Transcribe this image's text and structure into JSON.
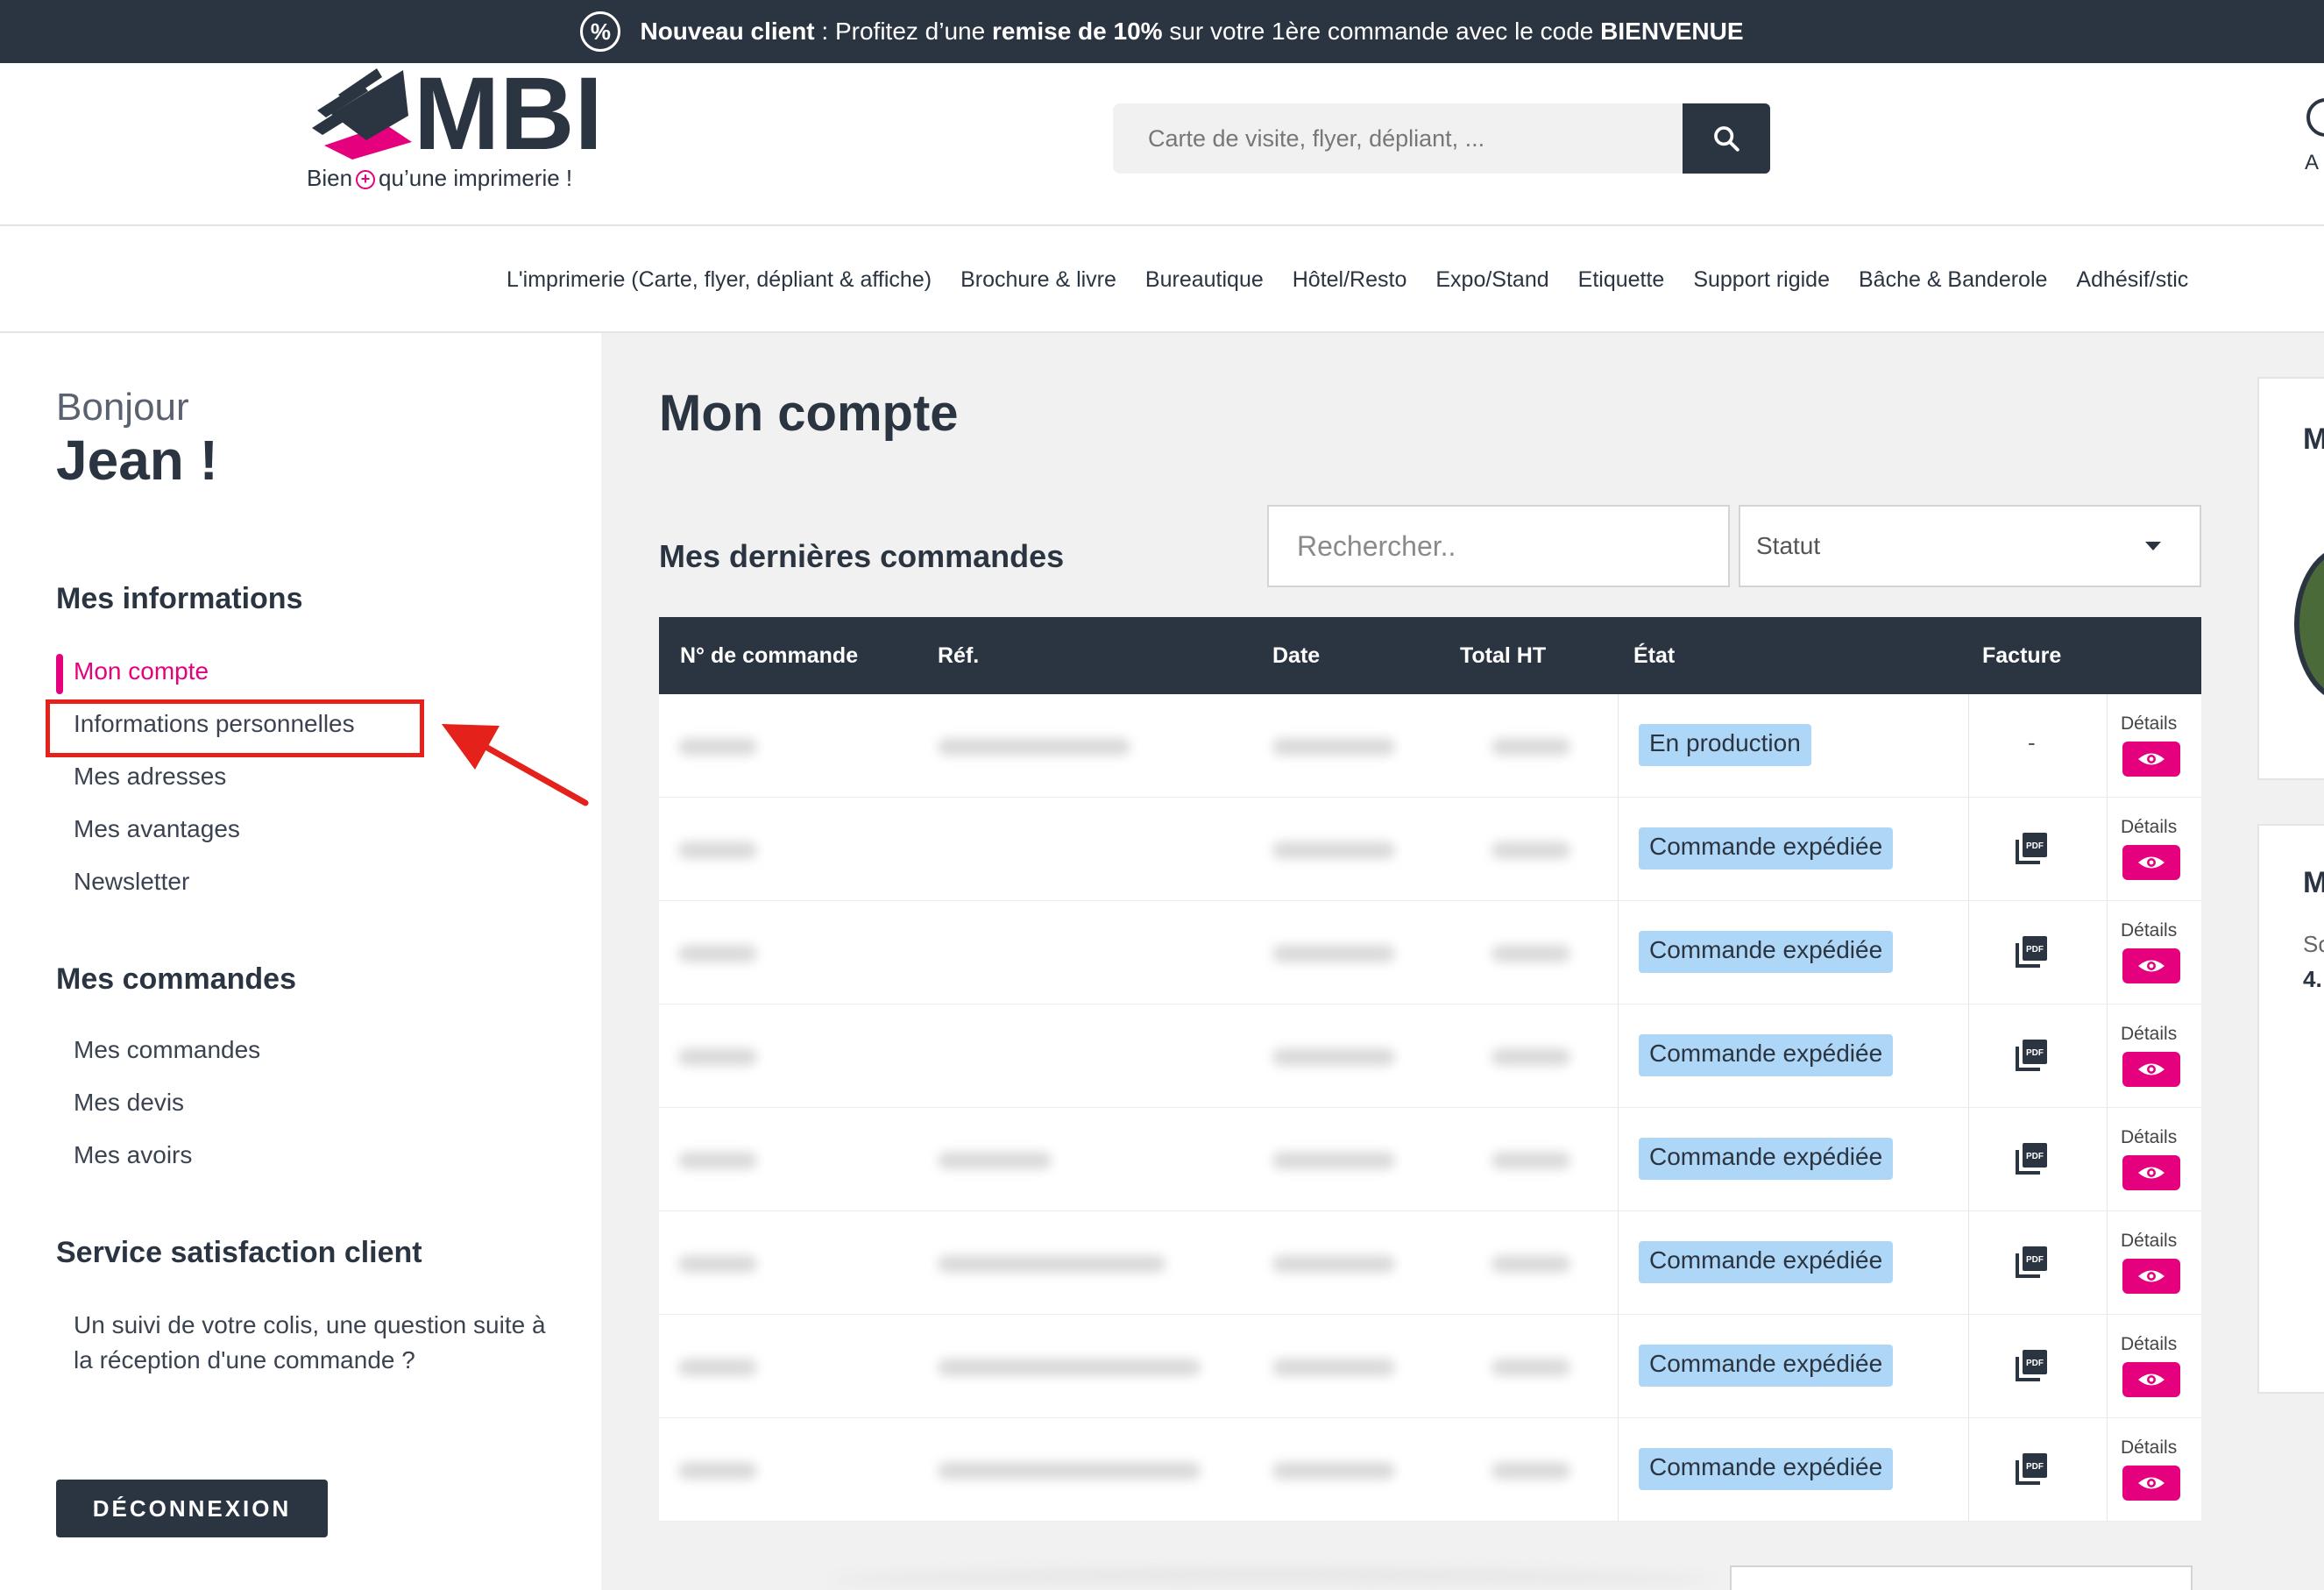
{
  "promo": {
    "lead": "Nouveau client",
    "sep": " : Profitez d’une ",
    "discount": "remise de 10%",
    "middle": " sur votre 1ère commande avec le code ",
    "code": "BIENVENUE",
    "icon": "percent-icon"
  },
  "header": {
    "logo_text": "MBI",
    "tagline_before": "Bien",
    "tagline_plus": "+",
    "tagline_after": "qu’une imprimerie !",
    "search_placeholder": "Carte de visite, flyer, dépliant, ...",
    "account_label": "A"
  },
  "nav": {
    "items": [
      "L'imprimerie (Carte, flyer, dépliant & affiche)",
      "Brochure & livre",
      "Bureautique",
      "Hôtel/Resto",
      "Expo/Stand",
      "Etiquette",
      "Support rigide",
      "Bâche & Banderole",
      "Adhésif/stic"
    ]
  },
  "sidebar": {
    "greeting": "Bonjour",
    "name": "Jean !",
    "info_title": "Mes informations",
    "info_links": [
      "Mon compte",
      "Informations personnelles",
      "Mes adresses",
      "Mes avantages",
      "Newsletter"
    ],
    "orders_title": "Mes commandes",
    "orders_links": [
      "Mes commandes",
      "Mes devis",
      "Mes avoirs"
    ],
    "service_title": "Service satisfaction client",
    "service_text": "Un suivi de votre colis, une question suite à la réception d'une commande ?",
    "logout": "DÉCONNEXION"
  },
  "main": {
    "title": "Mon compte",
    "orders_title": "Mes dernières commandes",
    "search_placeholder": "Rechercher..",
    "status_select": "Statut",
    "columns": {
      "number": "N° de commande",
      "ref": "Réf.",
      "date": "Date",
      "total": "Total HT",
      "state": "État",
      "invoice": "Facture"
    },
    "details_label": "Détails",
    "rows": [
      {
        "state": "En production",
        "invoice": "-"
      },
      {
        "state": "Commande expédiée",
        "invoice": "pdf"
      },
      {
        "state": "Commande expédiée",
        "invoice": "pdf"
      },
      {
        "state": "Commande expédiée",
        "invoice": "pdf"
      },
      {
        "state": "Commande expédiée",
        "invoice": "pdf"
      },
      {
        "state": "Commande expédiée",
        "invoice": "pdf"
      },
      {
        "state": "Commande expédiée",
        "invoice": "pdf"
      },
      {
        "state": "Commande expédiée",
        "invoice": "pdf"
      }
    ]
  },
  "right": {
    "card1_letter": "M",
    "card2_letter": "M",
    "card2_small1": "So",
    "card2_small2": "4."
  },
  "colors": {
    "navy": "#2b3441",
    "pink": "#e5007e",
    "badge_blue": "#aed6f7",
    "annotation_red": "#e4221b"
  }
}
